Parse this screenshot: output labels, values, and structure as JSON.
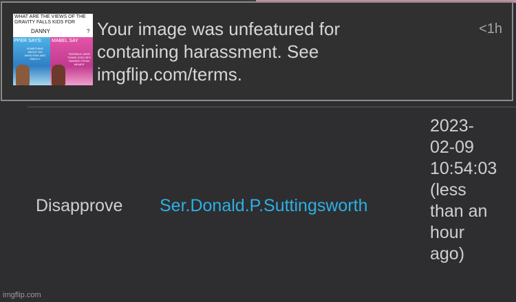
{
  "notification": {
    "thumbnail": {
      "title": "WHAT ARE THE VIEWS OF THE GRAVITY FALLS KIDS FOR",
      "name": "DANNY",
      "question_mark": "?",
      "left_label": "PPER SAYS:",
      "right_label": "MABEL SAY",
      "left_text": "SOMETHING ABOUT HIS ANNOYING AND SMELLY",
      "right_text": "TERRIBLE USER THANK GOD HE'S BANNED FROM MEMES"
    },
    "message_line1": "Your image was unfeatured for",
    "message_line2": "containing harassment. See",
    "message_line3": "imgflip.com/terms.",
    "time": "<1h"
  },
  "log_row": {
    "action": "Disapprove",
    "user": "Ser.Donald.P.Suttingsworth",
    "timestamp_lines": [
      "2023-",
      "02-09",
      "10:54:03",
      "(less",
      "than an",
      "hour",
      "ago)"
    ]
  },
  "watermark": "imgflip.com",
  "colors": {
    "background": "#2e2e30",
    "notification_border": "#8c8c8c",
    "link": "#2bb0e6",
    "text": "#cfcfcf"
  }
}
